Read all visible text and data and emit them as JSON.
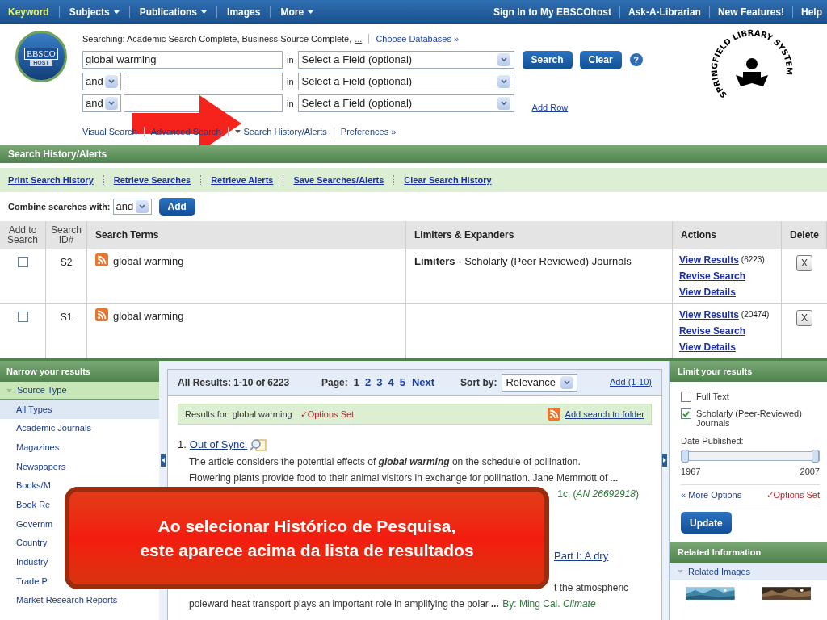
{
  "nav": {
    "left": [
      {
        "label": "Keyword",
        "selected": true,
        "dropdown": false
      },
      {
        "label": "Subjects",
        "selected": false,
        "dropdown": true
      },
      {
        "label": "Publications",
        "selected": false,
        "dropdown": true
      },
      {
        "label": "Images",
        "selected": false,
        "dropdown": false
      },
      {
        "label": "More",
        "selected": false,
        "dropdown": true
      }
    ],
    "right": [
      "Sign In to My EBSCOhost",
      "Ask-A-Librarian",
      "New Features!",
      "Help"
    ]
  },
  "logo": {
    "top": "EBSCO",
    "bottom": "HOST"
  },
  "library_logo": {
    "text": "SPRINGFIELD LIBRARY SYSTEM"
  },
  "search": {
    "searching_label": "Searching: Academic Search Complete, Business Source Complete,",
    "more_link": "...",
    "choose_link": "Choose Databases »",
    "rows": [
      {
        "operator": null,
        "value": "global warming",
        "in": "in",
        "field": "Select a Field (optional)"
      },
      {
        "operator": "and",
        "value": null,
        "in": "in",
        "field": "Select a Field (optional)"
      },
      {
        "operator": "and",
        "value": null,
        "in": "in",
        "field": "Select a Field (optional)"
      }
    ],
    "search_button": "Search",
    "clear_button": "Clear",
    "help": "?",
    "add_row": "Add Row",
    "links": [
      {
        "label": "Visual Search",
        "caret": false
      },
      {
        "label": "Advanced Search",
        "caret": false
      },
      {
        "label": "Search History/Alerts",
        "caret": true
      },
      {
        "label": "Preferences »",
        "caret": false
      }
    ]
  },
  "history": {
    "title": "Search History/Alerts",
    "links": [
      "Print Search History",
      "Retrieve Searches",
      "Retrieve Alerts",
      "Save Searches/Alerts",
      "Clear Search History"
    ],
    "combine_label": "Combine searches with:",
    "combine_value": "and",
    "add_button": "Add",
    "columns": [
      "Add to Search",
      "Search ID#",
      "Search Terms",
      "Limiters & Expanders",
      "Actions",
      "Delete"
    ],
    "rows": [
      {
        "checked": false,
        "id": "S2",
        "terms": "global warming",
        "limiter_label": "Limiters",
        "limiter_text": "- Scholarly (Peer Reviewed) Journals",
        "view": "View Results",
        "count": "(6223)",
        "revise": "Revise Search",
        "details": "View Details",
        "delete": "X"
      },
      {
        "checked": false,
        "id": "S1",
        "terms": "global warming",
        "limiter_label": null,
        "limiter_text": null,
        "view": "View Results",
        "count": "(20474)",
        "revise": "Revise Search",
        "details": "View Details",
        "delete": "X"
      }
    ]
  },
  "narrow": {
    "title": "Narrow your results",
    "section": "Source Type",
    "items": [
      {
        "label": "All Types",
        "selected": true
      },
      {
        "label": "Academic Journals",
        "selected": false
      },
      {
        "label": "Magazines",
        "selected": false
      },
      {
        "label": "Newspapers",
        "selected": false
      },
      {
        "label": "Books/M",
        "selected": false
      },
      {
        "label": "Book Re",
        "selected": false
      },
      {
        "label": "Governm",
        "selected": false
      },
      {
        "label": "Country",
        "selected": false
      },
      {
        "label": "Industry",
        "selected": false
      },
      {
        "label": "Trade P",
        "selected": false
      },
      {
        "label": "Market Research Reports",
        "selected": false
      }
    ]
  },
  "results": {
    "summary": "All Results: 1-10 of 6223",
    "page_label": "Page:",
    "pages": [
      {
        "label": "1",
        "selected": true
      },
      {
        "label": "2",
        "selected": false
      },
      {
        "label": "3",
        "selected": false
      },
      {
        "label": "4",
        "selected": false
      },
      {
        "label": "5",
        "selected": false
      }
    ],
    "next": "Next",
    "sort_label": "Sort by:",
    "sort_value": "Relevance",
    "add": "Add (1-10)",
    "results_for": "Results for: global warming",
    "options_set": "✓Options Set",
    "add_search": "Add search to folder",
    "item1": {
      "number": "1.",
      "title": "Out of Sync.",
      "lines": [
        "The article considers the potential effects of **global warming** on the schedule of pollination.",
        "Flowering plants provide food to their animal visitors in exchange for pollination. Jane Memmott of **...**"
      ],
      "fragment": "1c; (*AN 26692918*)"
    },
    "item2": {
      "title_fragment": "Part I: A dry",
      "fragment": "t the atmospheric",
      "snippet": "poleward heat transport plays an important role in amplifying the polar **...**",
      "source": "By: Ming Cai. *Climate*"
    }
  },
  "limit": {
    "title": "Limit your results",
    "options": [
      {
        "label": "Full Text",
        "checked": false
      },
      {
        "label": "Scholarly (Peer-Reviewed) Journals",
        "checked": true
      }
    ],
    "date_label": "Date Published:",
    "level": 1,
    "from": "1967",
    "to": "2007",
    "more": "« More Options",
    "options_set": "✓Options Set",
    "update": "Update"
  },
  "related": {
    "title": "Related Information",
    "section": "Related Images"
  },
  "callout": {
    "lines": [
      "Ao selecionar Histórico de Pesquisa,",
      "este aparece acima da lista de resultados"
    ]
  }
}
